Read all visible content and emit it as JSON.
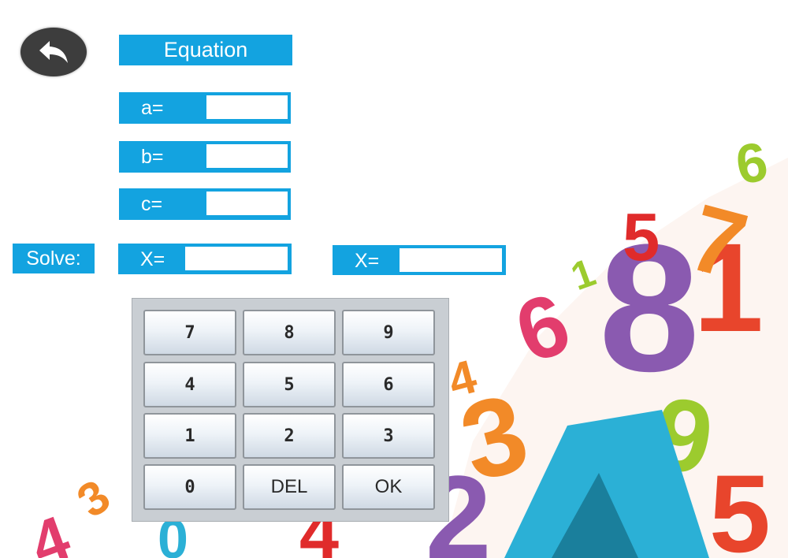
{
  "header": {
    "title": "Equation",
    "back_button": "back-arrow-icon"
  },
  "inputs": [
    {
      "label": "a=",
      "value": ""
    },
    {
      "label": "b=",
      "value": ""
    },
    {
      "label": "c=",
      "value": ""
    }
  ],
  "solve": {
    "label": "Solve:",
    "x1": {
      "label": "X=",
      "value": ""
    },
    "x2": {
      "label": "X=",
      "value": ""
    }
  },
  "keypad": {
    "keys": [
      [
        "7",
        "8",
        "9"
      ],
      [
        "4",
        "5",
        "6"
      ],
      [
        "1",
        "2",
        "3"
      ],
      [
        "0",
        "DEL",
        "OK"
      ]
    ]
  },
  "colors": {
    "accent": "#13a3e0",
    "back_button": "#3d3d3d",
    "keypad_bg": "#c9ced3"
  }
}
